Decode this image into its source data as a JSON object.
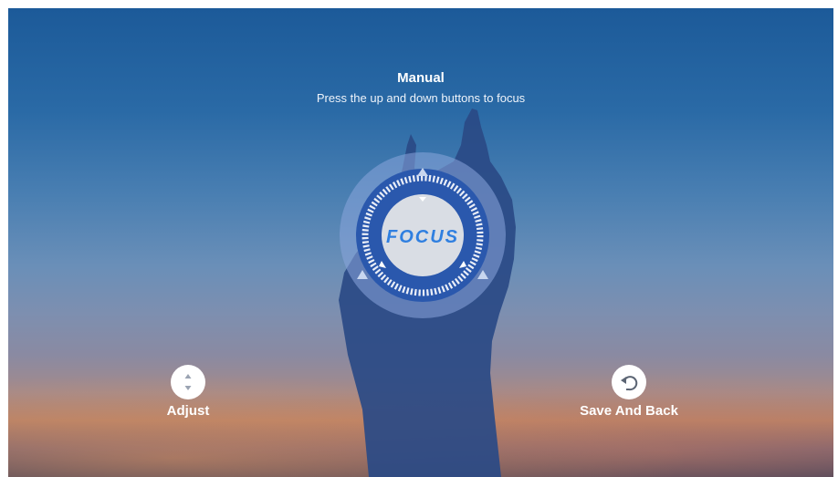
{
  "header": {
    "title": "Manual",
    "subtitle": "Press the up and down buttons to focus"
  },
  "dial": {
    "label": "FOCUS",
    "accent_color": "#2f7fe0",
    "ring_color": "#244c9e",
    "icons": [
      "triangle-up-icon",
      "triangle-left-icon",
      "triangle-right-icon"
    ]
  },
  "hints": {
    "adjust_label": "Adjust",
    "adjust_icon": "up-down-arrows-icon",
    "save_label": "Save And Back",
    "save_icon": "undo-arrow-icon"
  }
}
